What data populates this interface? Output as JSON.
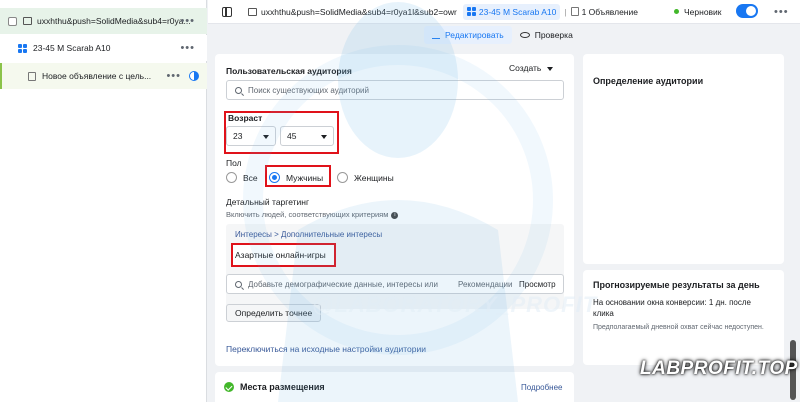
{
  "tree": {
    "campaign": "uxxhthu&push=SolidMedia&sub4=r0ya...",
    "adset": "23-45 M Scarab A10",
    "ad": "Новое объявление с цель..."
  },
  "topbar": {
    "breadcrumb_path": "uxxhthu&push=SolidMedia&sub4=r0ya1l&sub2=owr",
    "breadcrumb_adset": "23-45 M Scarab A10",
    "breadcrumb_ad": "1 Объявление",
    "status": "Черновик",
    "more": "•••"
  },
  "tabs": {
    "edit": "Редактировать",
    "review": "Проверка"
  },
  "audience": {
    "custom_audience_label": "Пользовательская аудитория",
    "create_label": "Создать",
    "search_placeholder": "Поиск существующих аудиторий",
    "age_label": "Возраст",
    "age_min": "23",
    "age_max": "45",
    "gender_label": "Пол",
    "gender_options": [
      "Все",
      "Мужчины",
      "Женщины"
    ],
    "gender_selected": "Мужчины",
    "detailed_label": "Детальный таргетинг",
    "detailed_hint": "Включить людей, соответствующих критериям",
    "path": "Интересы > Дополнительные интересы",
    "chip": "Азартные онлайн-игры",
    "detail_search_placeholder": "Добавьте демографические данные, интересы или",
    "recommendations": "Рекомендации",
    "browse": "Просмотр",
    "refine_button": "Определить точнее",
    "switch_link": "Переключиться на исходные настройки аудитории"
  },
  "placements": {
    "title": "Места размещения",
    "more": "Подробнее"
  },
  "right": {
    "definition_title": "Определение аудитории",
    "forecast_title": "Прогнозируемые результаты за день",
    "forecast_text": "На основании окна конверсии: 1 дн. после клика",
    "forecast_note": "Предполагаемый дневной охват сейчас недоступен."
  },
  "watermarks": {
    "center": "@LABORATORY_PROFIT",
    "brand": "LABPROFIT.TOP"
  },
  "colors": {
    "accent": "#1877f2",
    "highlight": "#e0121a",
    "status_green": "#42b72a"
  }
}
